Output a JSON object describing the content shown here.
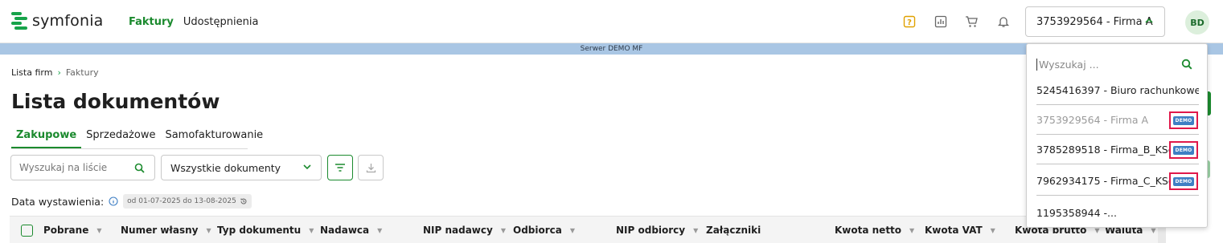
{
  "app": {
    "logo_text": "symfonia",
    "nav": [
      {
        "label": "Faktury",
        "active": true
      },
      {
        "label": "Udostępnienia",
        "active": false
      }
    ],
    "icons": [
      "help-icon",
      "report-icon",
      "cart-icon",
      "bell-icon"
    ],
    "company_selector": {
      "value": "3753929564 - Firma A"
    },
    "avatar": "BD",
    "accent_color": "#1b8a2e"
  },
  "server_banner": "Serwer DEMO MF",
  "breadcrumb": {
    "root": "Lista firm",
    "current": "Faktury"
  },
  "page_title": "Lista dokumentów",
  "tabs": [
    {
      "label": "Zakupowe",
      "active": true
    },
    {
      "label": "Sprzedażowe",
      "active": false
    },
    {
      "label": "Samofakturowanie",
      "active": false
    }
  ],
  "filters": {
    "search_placeholder": "Wyszukaj na liście",
    "document_type": "Wszystkie dokumenty"
  },
  "date_filter": {
    "label": "Data wystawienia:",
    "range": "od 01-07-2025 do 13-08-2025"
  },
  "table": {
    "columns": [
      "Pobrane",
      "Numer własny",
      "Typ dokumentu",
      "Nadawca",
      "NIP nadawcy",
      "Odbiorca",
      "NIP odbiorcy",
      "Załączniki",
      "Kwota netto",
      "Kwota VAT",
      "Kwota brutto",
      "Waluta"
    ]
  },
  "company_dropdown": {
    "search_placeholder": "Wyszukaj ...",
    "items": [
      {
        "label": "5245416397 - Biuro rachunkowe...",
        "demo": false,
        "disabled": false
      },
      {
        "label": "3753929564 - Firma A",
        "demo": true,
        "disabled": true
      },
      {
        "label": "3785289518 - Firma_B_KSeF",
        "demo": true,
        "disabled": false
      },
      {
        "label": "7962934175 - Firma_C_KSeF",
        "demo": true,
        "disabled": false
      },
      {
        "label": "1195358944 -...",
        "demo": false,
        "disabled": false
      }
    ],
    "demo_badge_text": "DEMO"
  }
}
